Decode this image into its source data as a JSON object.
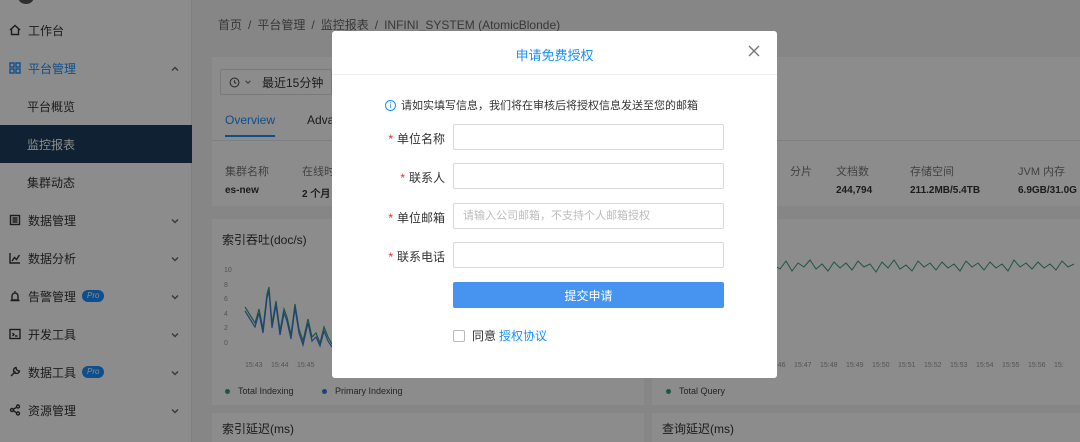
{
  "sidebar": {
    "items": [
      {
        "label": "工作台",
        "icon": "home-icon"
      },
      {
        "label": "平台管理",
        "icon": "cluster-icon"
      },
      {
        "label": "平台概览"
      },
      {
        "label": "监控报表"
      },
      {
        "label": "集群动态"
      },
      {
        "label": "数据管理",
        "icon": "database-icon"
      },
      {
        "label": "数据分析",
        "icon": "chart-icon"
      },
      {
        "label": "告警管理",
        "icon": "alarm-icon",
        "badge": "Pro"
      },
      {
        "label": "开发工具",
        "icon": "code-icon"
      },
      {
        "label": "数据工具",
        "icon": "wrench-icon",
        "badge": "Pro"
      },
      {
        "label": "资源管理",
        "icon": "share-icon"
      }
    ]
  },
  "breadcrumb": [
    "首页",
    "/",
    "平台管理",
    "/",
    "监控报表",
    "/",
    "INFINI_SYSTEM (AtomicBlonde)"
  ],
  "toolbar": {
    "time_range": "最近15分钟"
  },
  "tabs": [
    "Overview",
    "Adva"
  ],
  "stats": [
    {
      "label": "集群名称",
      "value": "es-new"
    },
    {
      "label": "在线时",
      "value": "2 个月"
    },
    {
      "label": "分片",
      "value": ""
    },
    {
      "label": "文档数",
      "value": "244,794"
    },
    {
      "label": "存储空间",
      "value": "211.2MB/5.4TB"
    },
    {
      "label": "JVM 内存",
      "value": "6.9GB/31.0G"
    }
  ],
  "charts": {
    "indexing": {
      "title": "索引吞吐(doc/s)",
      "y_ticks": [
        "10",
        "8",
        "6",
        "4",
        "2",
        "0"
      ],
      "x_ticks": [
        "15:43",
        "15:44",
        "15:45"
      ],
      "legend": [
        "Total Indexing",
        "Primary Indexing"
      ]
    },
    "query": {
      "x_ticks": [
        "15:46",
        "15:47",
        "15:48",
        "15:49",
        "15:50",
        "15:51",
        "15:52",
        "15:53",
        "15:54",
        "15:55",
        "15:56",
        "15:"
      ],
      "legend": [
        "Total Query"
      ]
    },
    "index_latency_title": "索引延迟(ms)",
    "query_latency_title": "查询延迟(ms)"
  },
  "modal": {
    "title": "申请免费授权",
    "notice": "请如实填写信息，我们将在审核后将授权信息发送至您的邮箱",
    "fields": [
      {
        "label": "单位名称",
        "value": "",
        "placeholder": ""
      },
      {
        "label": "联系人",
        "value": "",
        "placeholder": ""
      },
      {
        "label": "单位邮箱",
        "value": "",
        "placeholder": "请输入公司邮箱，不支持个人邮箱授权"
      },
      {
        "label": "联系电话",
        "value": "",
        "placeholder": ""
      }
    ],
    "submit_label": "提交申请",
    "agree_text": "同意",
    "agree_link": "授权协议"
  },
  "colors": {
    "accent": "#1890ff",
    "sidebar_selected": "#1d3c5c",
    "required": "#f5222d",
    "series_green": "#3a9b7a",
    "series_blue": "#3d78d8"
  }
}
